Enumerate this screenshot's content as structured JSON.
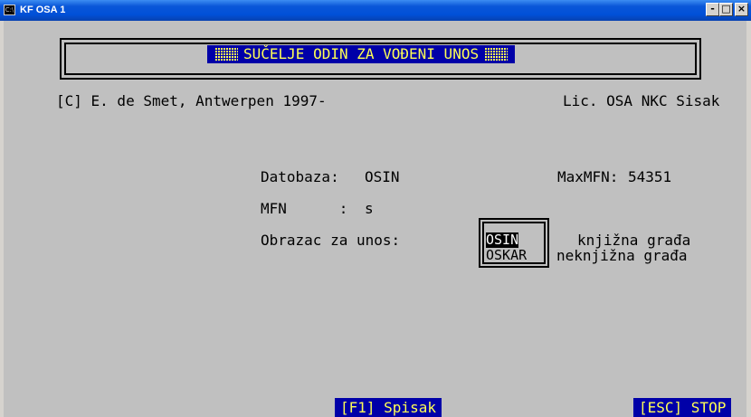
{
  "window": {
    "title": "KF OSA 1",
    "icon_label": "C:\\",
    "controls": {
      "minimize": "-",
      "maximize": "□",
      "close": "×"
    }
  },
  "header": {
    "banner": "SUČELJE ODIN ZA VOĐENI UNOS"
  },
  "info": {
    "copyright": "[C] E. de Smet, Antwerpen 1997-",
    "license": "Lic. OSA NKC Sisak"
  },
  "form": {
    "database_label": "Datobaza:",
    "database_value": "OSIN",
    "maxmfn_label": "MaxMFN:",
    "maxmfn_value": "54351",
    "mfn_label": "MFN      :",
    "mfn_value": "s",
    "template_label": "Obrazac za unos:",
    "templates": [
      {
        "code": "OSIN",
        "description": "knjižna građa",
        "selected": true
      },
      {
        "code": "OSKAR",
        "description": "neknjižna građa",
        "selected": false
      }
    ]
  },
  "footer": {
    "f1": "[F1] Spisak",
    "esc": "[ESC] STOP"
  },
  "colors": {
    "console_bg": "#c0c0c0",
    "banner_bg": "#0000a8",
    "banner_fg": "#ffff55",
    "titlebar": "#0a57d8"
  }
}
